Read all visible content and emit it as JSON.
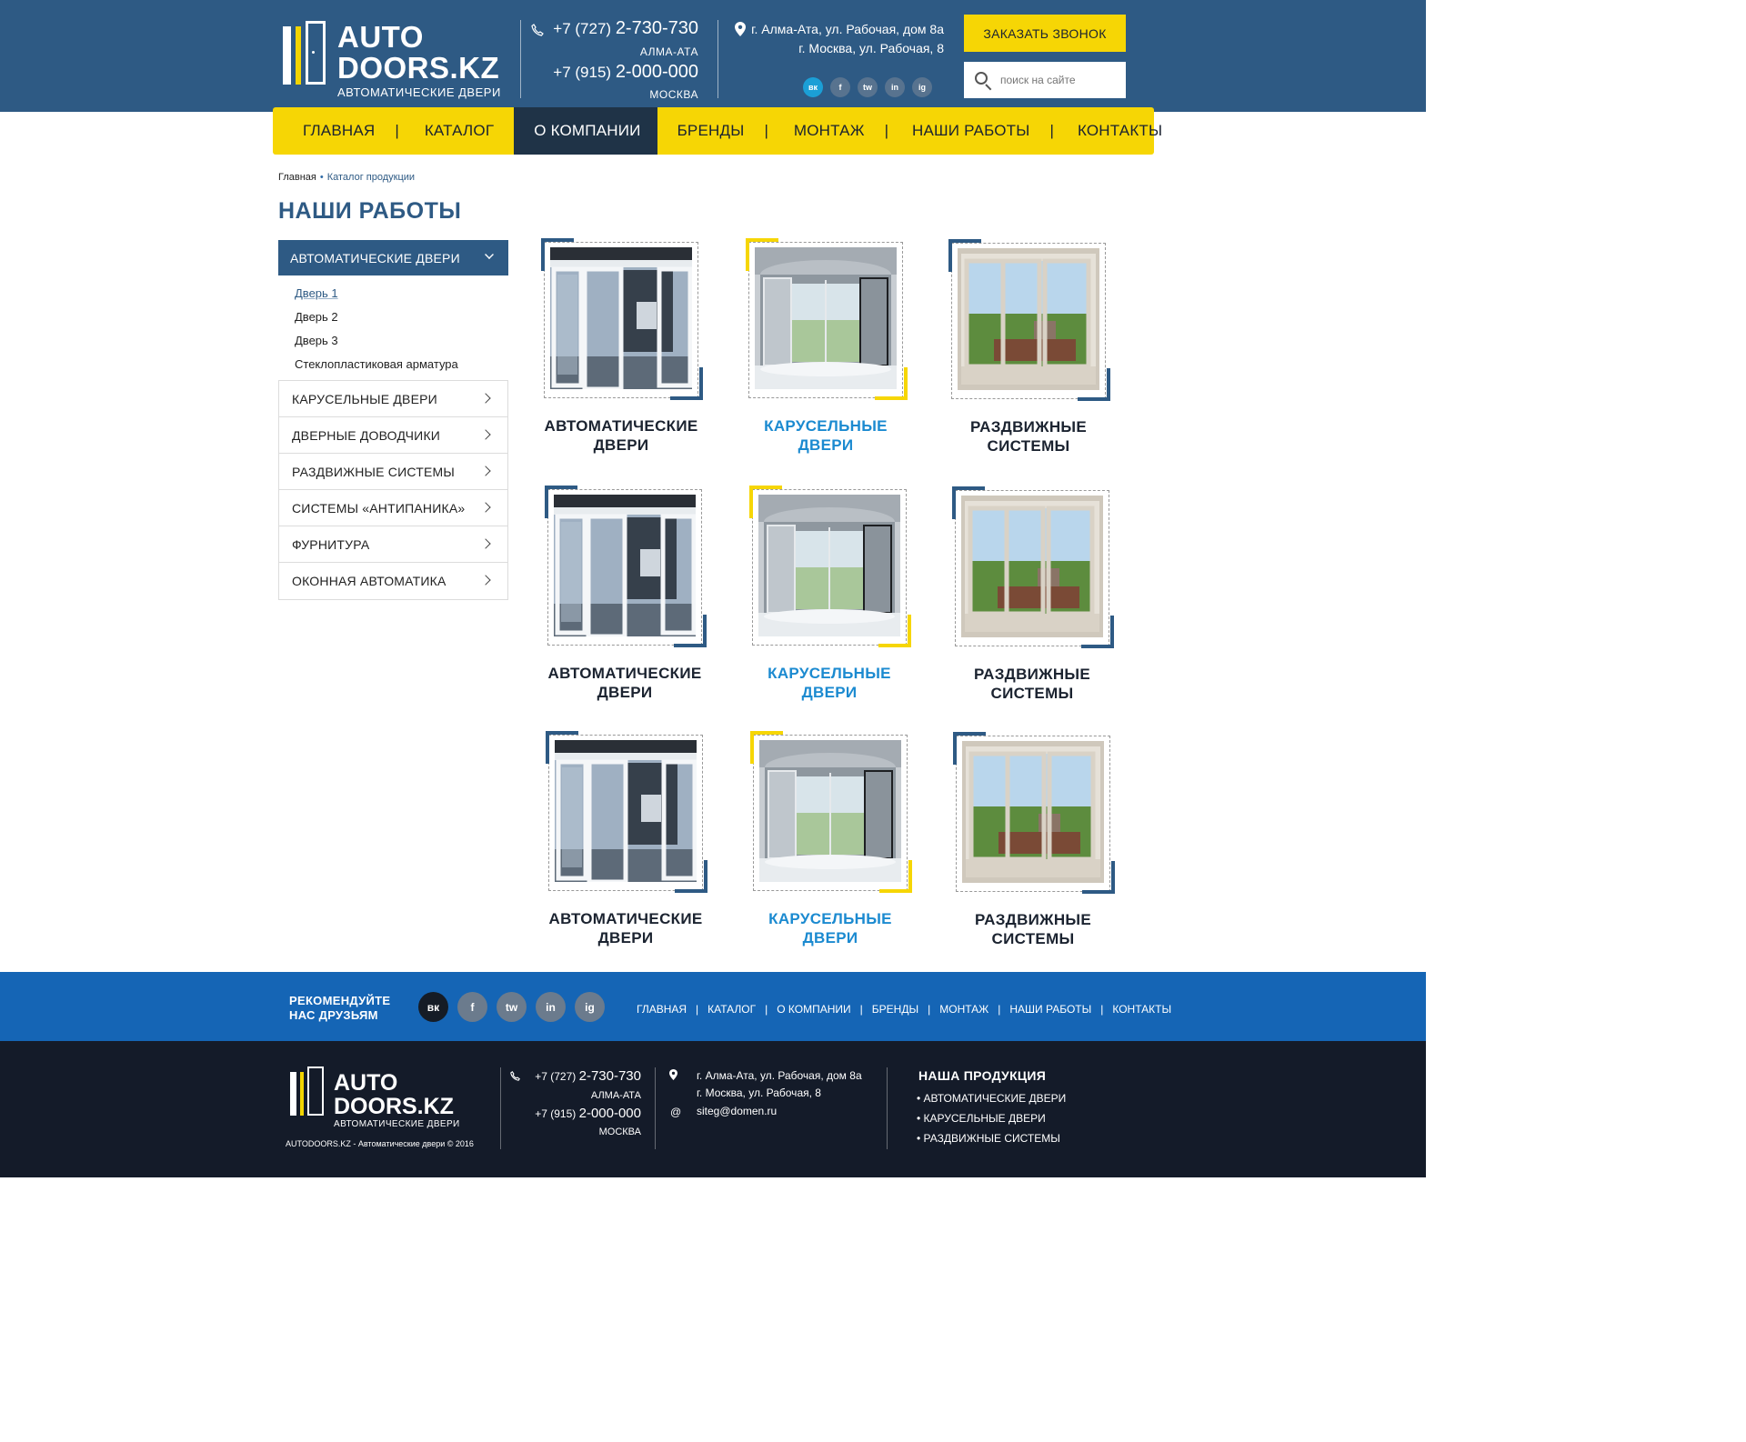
{
  "header": {
    "logo_line1": "AUTO",
    "logo_line2": "DOORS.KZ",
    "logo_sub": "АВТОМАТИЧЕСКИЕ ДВЕРИ",
    "phone1_prefix": "+7 (727)",
    "phone1_number": "2-730-730",
    "phone1_city": "АЛМА-АТА",
    "phone2_prefix": "+7 (915)",
    "phone2_number": "2-000-000",
    "phone2_city": "МОСКВА",
    "address1": "г. Алма-Ата, ул. Рабочая, дом 8а",
    "address2": "г. Москва, ул. Рабочая, 8",
    "social": [
      "вк",
      "f",
      "tw",
      "in",
      "ig"
    ],
    "call_button": "ЗАКАЗАТЬ ЗВОНОК",
    "search_placeholder": "поиск на сайте"
  },
  "nav": {
    "items": [
      "ГЛАВНАЯ",
      "КАТАЛОГ",
      "О КОМПАНИИ",
      "БРЕНДЫ",
      "МОНТАЖ",
      "НАШИ РАБОТЫ",
      "КОНТАКТЫ"
    ],
    "active": "О КОМПАНИИ"
  },
  "breadcrumb": {
    "home": "Главная",
    "current": "Каталог продукции"
  },
  "page_title": "НАШИ РАБОТЫ",
  "sidebar": {
    "active_section": "АВТОМАТИЧЕСКИЕ ДВЕРИ",
    "sub_items": [
      "Дверь 1",
      "Дверь 2",
      "Дверь 3",
      "Стеклопластиковая арматура"
    ],
    "sections": [
      "КАРУСЕЛЬНЫЕ ДВЕРИ",
      "ДВЕРНЫЕ ДОВОДЧИКИ",
      "РАЗДВИЖНЫЕ СИСТЕМЫ",
      "СИСТЕМЫ «АНТИПАНИКА»",
      "ФУРНИТУРА",
      "ОКОННАЯ АВТОМАТИКА"
    ]
  },
  "gallery": {
    "cards": [
      {
        "line1": "АВТОМАТИЧЕСКИЕ",
        "line2": "ДВЕРИ"
      },
      {
        "line1": "КАРУСЕЛЬНЫЕ",
        "line2": "ДВЕРИ"
      },
      {
        "line1": "РАЗДВИЖНЫЕ",
        "line2": "СИСТЕМЫ"
      },
      {
        "line1": "АВТОМАТИЧЕСКИЕ",
        "line2": "ДВЕРИ"
      },
      {
        "line1": "КАРУСЕЛЬНЫЕ",
        "line2": "ДВЕРИ"
      },
      {
        "line1": "РАЗДВИЖНЫЕ",
        "line2": "СИСТЕМЫ"
      },
      {
        "line1": "АВТОМАТИЧЕСКИЕ",
        "line2": "ДВЕРИ"
      },
      {
        "line1": "КАРУСЕЛЬНЫЕ",
        "line2": "ДВЕРИ"
      },
      {
        "line1": "РАЗДВИЖНЫЕ",
        "line2": "СИСТЕМЫ"
      }
    ]
  },
  "footer": {
    "recommend_line1": "РЕКОМЕНДУЙТЕ",
    "recommend_line2": "НАС ДРУЗЬЯМ",
    "social": [
      "вк",
      "f",
      "tw",
      "in",
      "ig"
    ],
    "nav": [
      "ГЛАВНАЯ",
      "КАТАЛОГ",
      "О КОМПАНИИ",
      "БРЕНДЫ",
      "МОНТАЖ",
      "НАШИ РАБОТЫ",
      "КОНТАКТЫ"
    ],
    "logo_line1": "AUTO",
    "logo_line2": "DOORS.KZ",
    "logo_sub": "АВТОМАТИЧЕСКИЕ ДВЕРИ",
    "copyright": "AUTODOORS.KZ - Автоматические двери © 2016",
    "phone1_prefix": "+7 (727)",
    "phone1_number": "2-730-730",
    "phone1_city": "АЛМА-АТА",
    "phone2_prefix": "+7 (915)",
    "phone2_number": "2-000-000",
    "phone2_city": "МОСКВА",
    "address1": "г. Алма-Ата, ул. Рабочая, дом 8а",
    "address2": "г. Москва, ул. Рабочая, 8",
    "email": "siteg@domen.ru",
    "products_title": "НАША ПРОДУКЦИЯ",
    "products": [
      "• АВТОМАТИЧЕСКИЕ ДВЕРИ",
      "• КАРУСЕЛЬНЫЕ ДВЕРИ",
      "• РАЗДВИЖНЫЕ СИСТЕМЫ"
    ]
  },
  "colors": {
    "header_blue": "#2e5a84",
    "accent_yellow": "#f6d605",
    "nav_active": "#1f3347",
    "link_blue": "#1b8ad0",
    "footer_blue": "#1565b5",
    "footer_dark": "#141b29"
  }
}
